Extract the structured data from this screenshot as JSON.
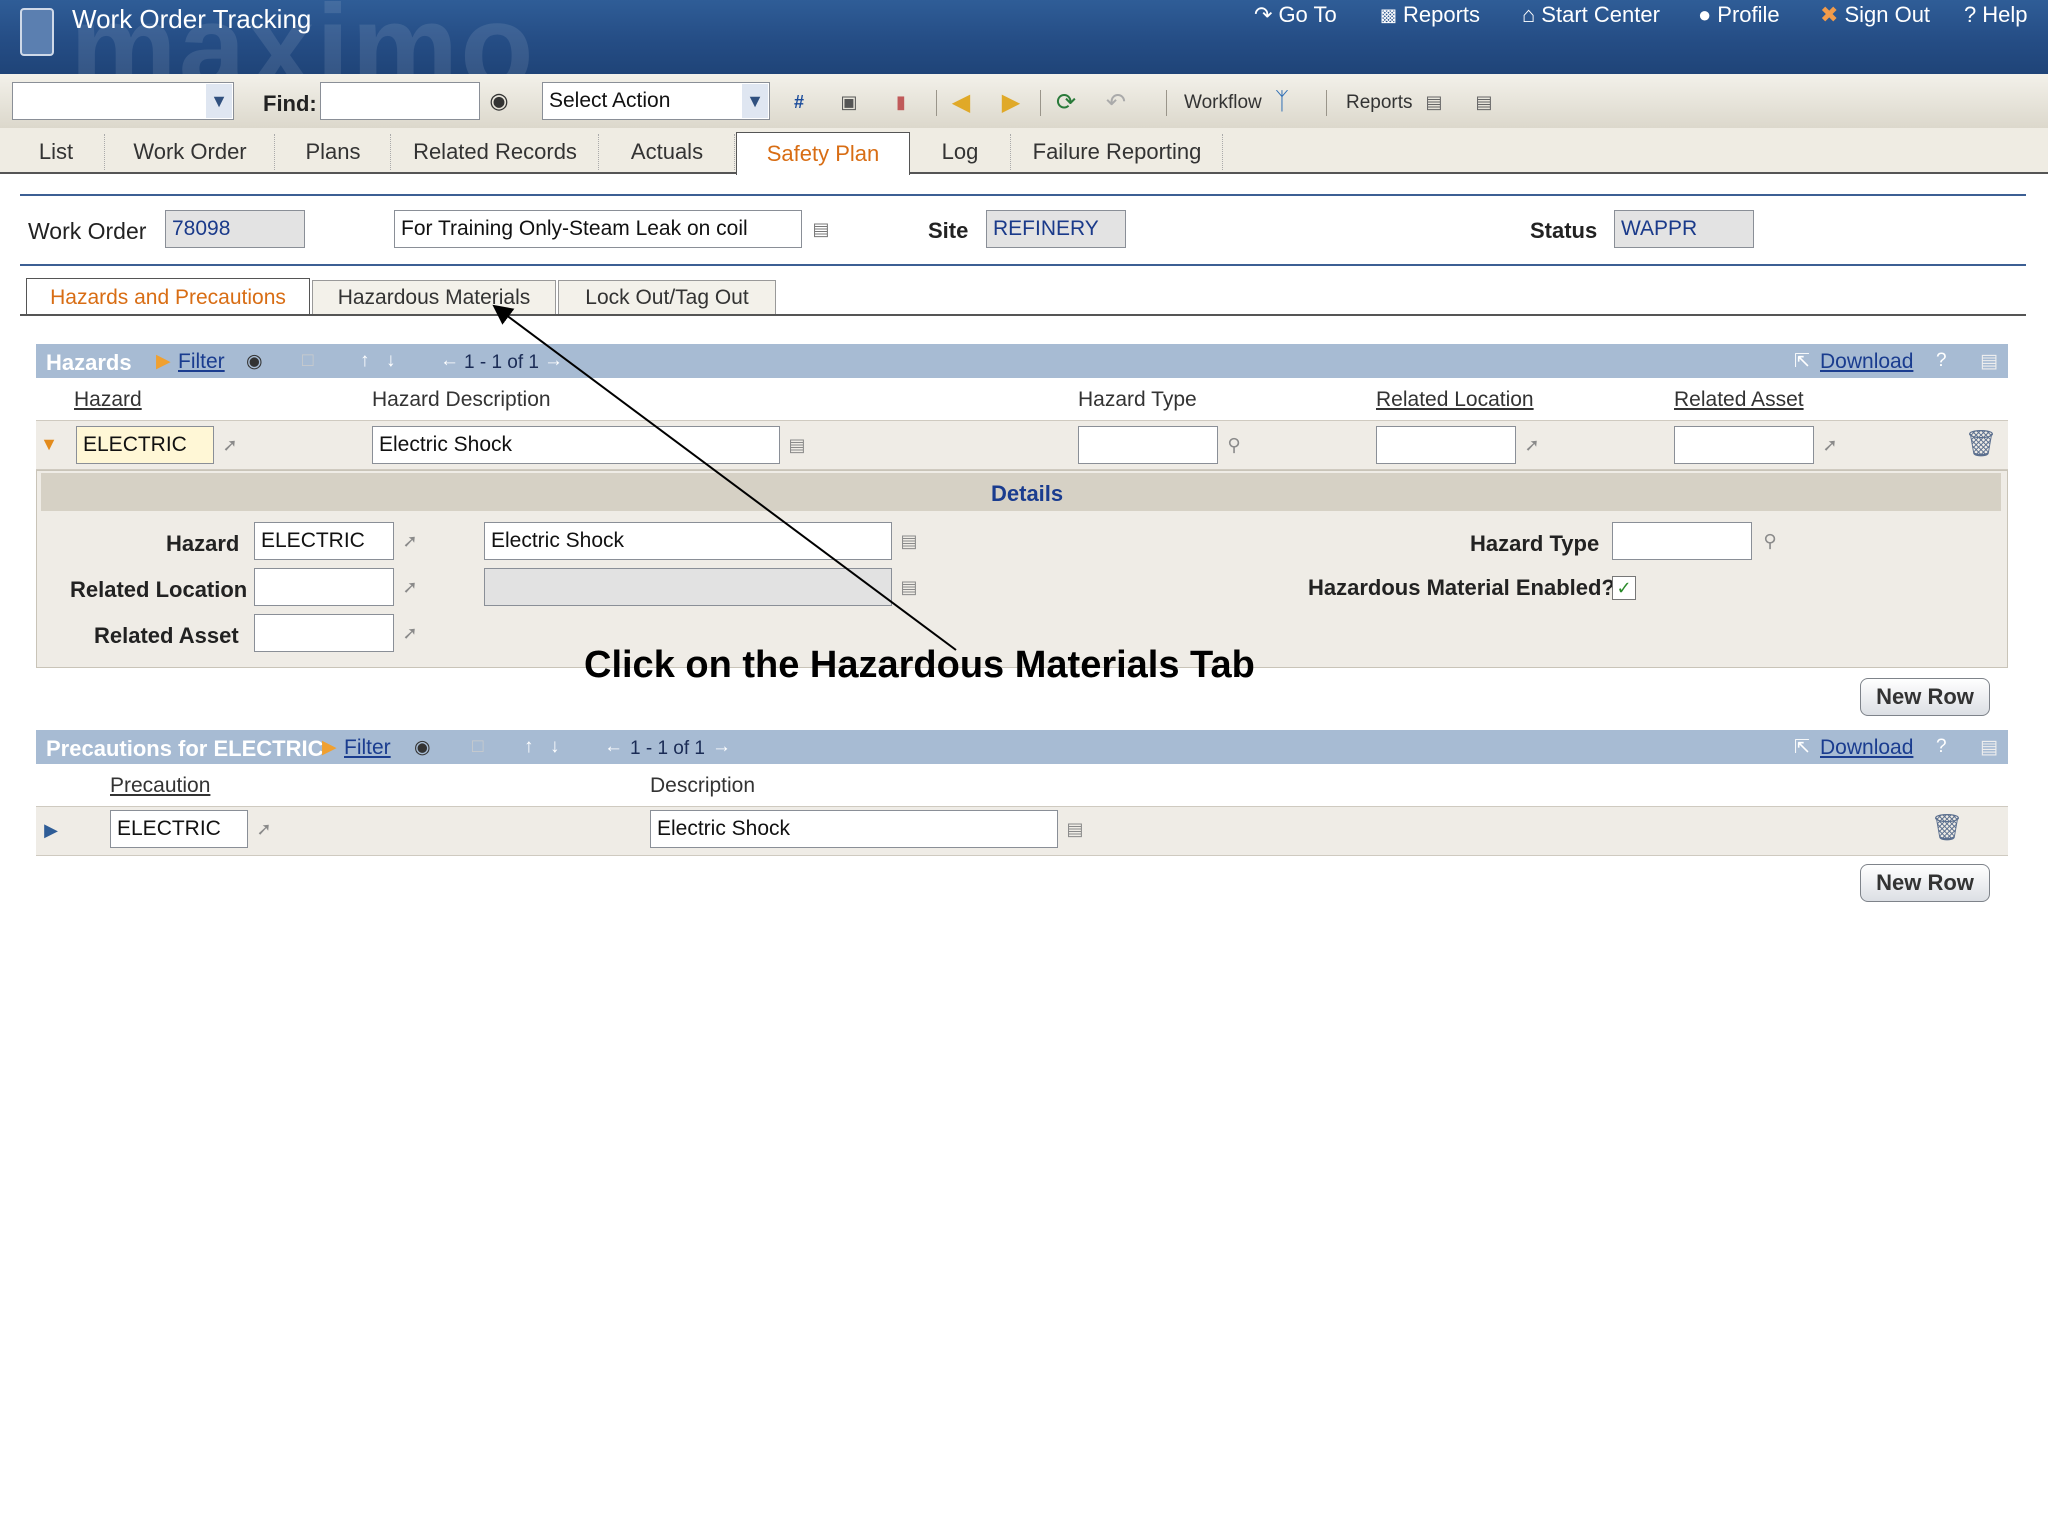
{
  "header": {
    "title": "Work Order Tracking",
    "watermark": "maximo",
    "links": [
      "Go To",
      "Reports",
      "Start Center",
      "Profile",
      "Sign Out",
      "Help"
    ]
  },
  "toolbar": {
    "find_label": "Find:",
    "action_select": "Select Action",
    "workflow_label": "Workflow",
    "reports_label": "Reports"
  },
  "main_tabs": [
    "List",
    "Work Order",
    "Plans",
    "Related Records",
    "Actuals",
    "Safety Plan",
    "Log",
    "Failure Reporting"
  ],
  "work_order": {
    "label": "Work Order",
    "number": "78098",
    "description": "For Training Only-Steam Leak on coil",
    "site_label": "Site",
    "site": "REFINERY",
    "status_label": "Status",
    "status": "WAPPR"
  },
  "sub_tabs": [
    "Hazards and Precautions",
    "Hazardous Materials",
    "Lock Out/Tag Out"
  ],
  "hazards": {
    "title": "Hazards",
    "filter": "Filter",
    "paging": "1 - 1 of 1",
    "download": "Download",
    "help": "?",
    "columns": [
      "Hazard",
      "Hazard Description",
      "Hazard Type",
      "Related Location",
      "Related Asset"
    ],
    "row": {
      "hazard": "ELECTRIC",
      "description": "Electric Shock",
      "type": "",
      "location": "",
      "asset": ""
    }
  },
  "details": {
    "title": "Details",
    "hazard_label": "Hazard",
    "hazard": "ELECTRIC",
    "hazard_desc": "Electric Shock",
    "related_location_label": "Related Location",
    "related_asset_label": "Related Asset",
    "hazard_type_label": "Hazard Type",
    "hazmat_label": "Hazardous Material Enabled?",
    "hazmat_enabled": true
  },
  "annotation": "Click on the Hazardous Materials Tab",
  "new_row_label": "New Row",
  "precautions": {
    "title": "Precautions for ELECTRIC",
    "filter": "Filter",
    "paging": "1 - 1 of 1",
    "download": "Download",
    "help": "?",
    "columns": [
      "Precaution",
      "Description"
    ],
    "row": {
      "precaution": "ELECTRIC",
      "description": "Electric Shock"
    }
  },
  "colors": {
    "header_blue": "#2a5592",
    "active_tab": "#d86d14",
    "section_bar": "#a7bbd3"
  }
}
